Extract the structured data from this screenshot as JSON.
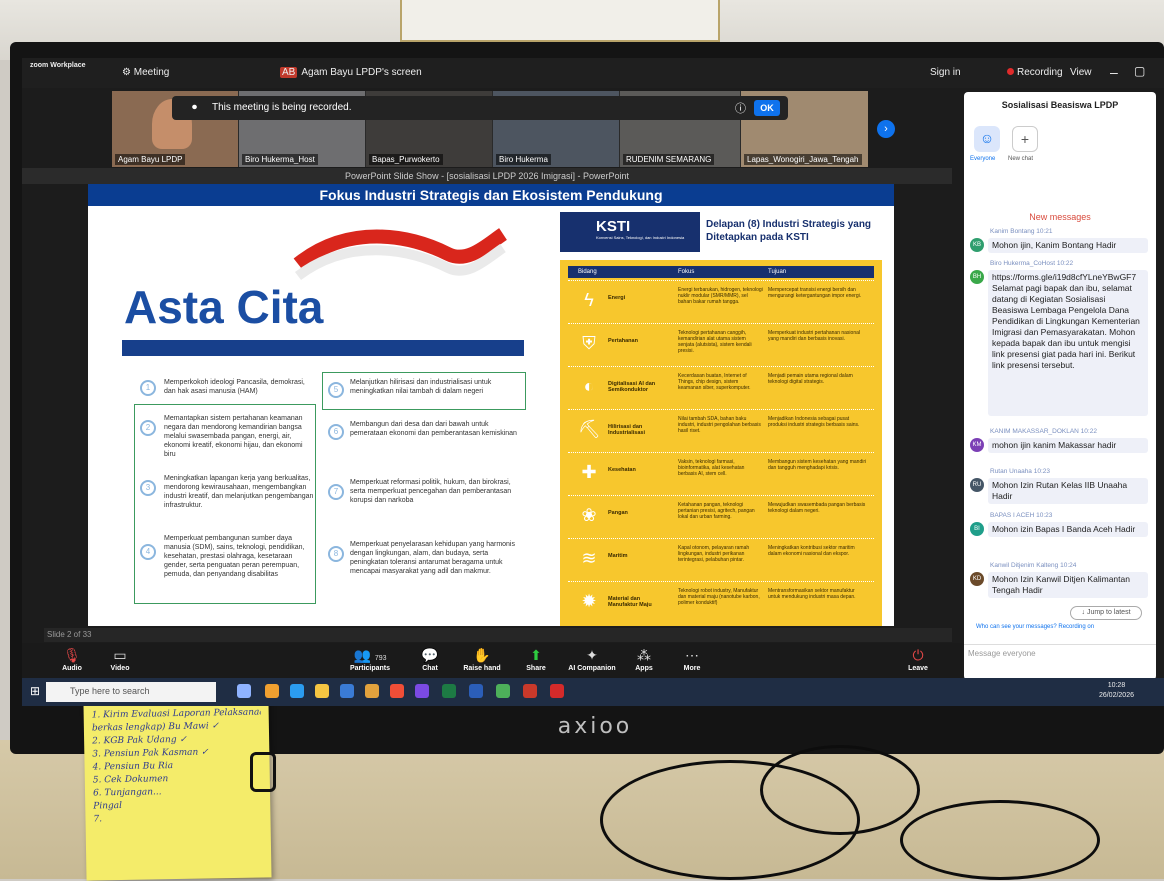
{
  "zoom": {
    "app_name": "zoom Workplace",
    "meeting_tab": "Meeting",
    "screen_tab": "Agam Bayu LPDP's screen",
    "sign_in": "Sign in",
    "recording": "Recording",
    "view": "View",
    "recording_banner": "This meeting is being recorded.",
    "ok": "OK",
    "participants_tiles": [
      "Agam Bayu LPDP",
      "Biro Hukerma_Host",
      "Bapas_Purwokerto",
      "Biro Hukerma",
      "RUDENIM SEMARANG",
      "Lapas_Wonogiri_Jawa_Tengah"
    ],
    "toolbar": {
      "audio": "Audio",
      "video": "Video",
      "participants": "Participants",
      "participants_count": "793",
      "chat": "Chat",
      "raise_hand": "Raise hand",
      "share": "Share",
      "ai_companion": "AI Companion",
      "apps": "Apps",
      "more": "More",
      "leave": "Leave"
    }
  },
  "ppt": {
    "window_title": "PowerPoint Slide Show - [sosialisasi LPDP 2026 Imigrasi] - PowerPoint",
    "status": "Slide 2 of 33",
    "slide": {
      "heading": "Fokus Industri Strategis dan Ekosistem Pendukung",
      "asta_cita": "Asta Cita",
      "items_left": [
        {
          "n": "1",
          "text": "Memperkokoh ideologi Pancasila, demokrasi, dan hak asasi manusia (HAM)"
        },
        {
          "n": "2",
          "text": "Memantapkan sistem pertahanan keamanan negara dan mendorong kemandirian bangsa melalui swasembada pangan, energi, air, ekonomi kreatif, ekonomi hijau, dan ekonomi biru"
        },
        {
          "n": "3",
          "text": "Meningkatkan lapangan kerja yang berkualitas, mendorong kewirausahaan, mengembangkan industri kreatif, dan melanjutkan pengembangan infrastruktur."
        },
        {
          "n": "4",
          "text": "Memperkuat pembangunan sumber daya manusia (SDM), sains, teknologi, pendidikan, kesehatan, prestasi olahraga, kesetaraan gender, serta penguatan peran perempuan, pemuda, dan penyandang disabilitas"
        }
      ],
      "items_right": [
        {
          "n": "5",
          "text": "Melanjutkan hilirisasi dan industrialisasi untuk meningkatkan nilai tambah di dalam negeri"
        },
        {
          "n": "6",
          "text": "Membangun dari desa dan dari bawah untuk pemerataan ekonomi dan pemberantasan kemiskinan"
        },
        {
          "n": "7",
          "text": "Memperkuat reformasi politik, hukum, dan birokrasi, serta memperkuat pencegahan dan pemberantasan korupsi dan narkoba"
        },
        {
          "n": "8",
          "text": "Memperkuat penyelarasan kehidupan yang harmonis dengan lingkungan, alam, dan budaya, serta peningkatan toleransi antarumat beragama untuk mencapai masyarakat yang adil dan makmur."
        }
      ],
      "ksti_logo": "KSTI",
      "ksti_sub": "Konvensi Sains, Teknologi, dan Industri Indonesia",
      "ksti_title": "Delapan (8) Industri Strategis yang Ditetapkan pada KSTI",
      "table_headers": [
        "Bidang",
        "Fokus",
        "Tujuan"
      ],
      "rows": [
        {
          "bidang": "Energi",
          "fokus": "Energi terbarukan, hidrogen, teknologi nuklir modular (SMR/MMR), sel bahan bakar rumah tangga.",
          "tujuan": "Mempercepat transisi energi bersih dan mengurangi ketergantungan impor energi."
        },
        {
          "bidang": "Pertahanan",
          "fokus": "Teknologi pertahanan canggih, kemandirian alat utama sistem senjata (alutsista), sistem kendali presisi.",
          "tujuan": "Memperkuat industri pertahanan nasional yang mandiri dan berbasis inovasi."
        },
        {
          "bidang": "Digitalisasi AI dan Semikonduktor",
          "fokus": "Kecerdasan buatan, Internet of Things, chip design, sistem keamanan siber, superkomputer.",
          "tujuan": "Menjadi pemain utama regional dalam teknologi digital strategis."
        },
        {
          "bidang": "Hilirisasi dan Industrialisasi",
          "fokus": "Nilai tambah SDA, bahan baku industri, industri pengolahan berbasis hasil riset.",
          "tujuan": "Menjadikan Indonesia sebagai pusat produksi industri strategis berbasis sains."
        },
        {
          "bidang": "Kesehatan",
          "fokus": "Vaksin, teknologi farmasi, bioinformatika, alat kesehatan berbasis AI, stem cell.",
          "tujuan": "Membangun sistem kesehatan yang mandiri dan tangguh menghadapi krisis."
        },
        {
          "bidang": "Pangan",
          "fokus": "Ketahanan pangan, teknologi pertanian presisi, agritech, pangan lokal dan urban farming.",
          "tujuan": "Mewujudkan swasembada pangan berbasis teknologi dalam negeri."
        },
        {
          "bidang": "Maritim",
          "fokus": "Kapal otonom, pelayaran ramah lingkungan, industri perikanan terintegrasi, pelabuhan pintar.",
          "tujuan": "Meningkatkan kontribusi sektor maritim dalam ekonomi nasional dan ekspor."
        },
        {
          "bidang": "Material dan Manufaktur Maju",
          "fokus": "Teknologi robot industry, Manufaktur dan material maju (nanotube karbon, polimer konduktif)",
          "tujuan": "Mentransformasikan sektor manufaktur untuk mendukung industri masa depan."
        }
      ],
      "page_number": "2"
    }
  },
  "chat": {
    "title": "Sosialisasi Beasiswa LPDP",
    "tab_everyone": "Everyone",
    "tab_new": "New chat",
    "new_messages": "New messages",
    "messages": [
      {
        "initials": "KB",
        "color": "#2f9e6e",
        "sender": "Kanim Bontang 10:21",
        "text": "Mohon ijin, Kanim Bontang Hadir"
      },
      {
        "initials": "BH",
        "color": "#3aa84a",
        "sender": "Biro Hukerma_CoHost 10:22",
        "text": "https://forms.gle/i19d8cfYLneYBwGF7 Selamat pagi bapak dan ibu, selamat datang di Kegiatan Sosialisasi Beasiswa Lembaga Pengelola Dana Pendidikan di Lingkungan Kementerian Imigrasi dan Pemasyarakatan. Mohon kepada bapak dan ibu untuk mengisi link presensi giat pada hari ini. Berikut link presensi tersebut."
      },
      {
        "initials": "KM",
        "color": "#7b3fb5",
        "sender": "KANIM MAKASSAR_DOKLAN 10:22",
        "text": "mohon ijin kanim Makassar hadir"
      },
      {
        "initials": "RU",
        "color": "#456",
        "sender": "Rutan Unaaha 10:23",
        "text": "Mohon Izin Rutan Kelas IIB Unaaha Hadir"
      },
      {
        "initials": "BI",
        "color": "#1f9e8a",
        "sender": "BAPAS I ACEH 10:23",
        "text": "Mohon izin Bapas I Banda Aceh Hadir"
      },
      {
        "initials": "KD",
        "color": "#6b4a2a",
        "sender": "Kanwil Ditjenim Kalteng 10:24",
        "text": "Mohon Izin Kanwil Ditjen Kalimantan Tengah Hadir"
      }
    ],
    "jump_latest": "Jump to latest",
    "who_can_see": "Who can see your messages? Recording on",
    "input_placeholder": "Message everyone"
  },
  "taskbar": {
    "search_placeholder": "Type here to search",
    "time": "10:28",
    "date": "26/02/2026"
  },
  "monitor_brand": "axioo",
  "sticky_note": [
    "1. Kirim Evaluasi Laporan Pelaksanaan",
    "   berkas lengkap) Bu Mawi ✓",
    "2. KGB Pak Udang ✓",
    "3. Pensiun Pak Kasman ✓",
    "4. Pensiun Bu Ria",
    "5. Cek Dokumen",
    "6. Tunjangan...",
    "   Pingal",
    "7."
  ]
}
